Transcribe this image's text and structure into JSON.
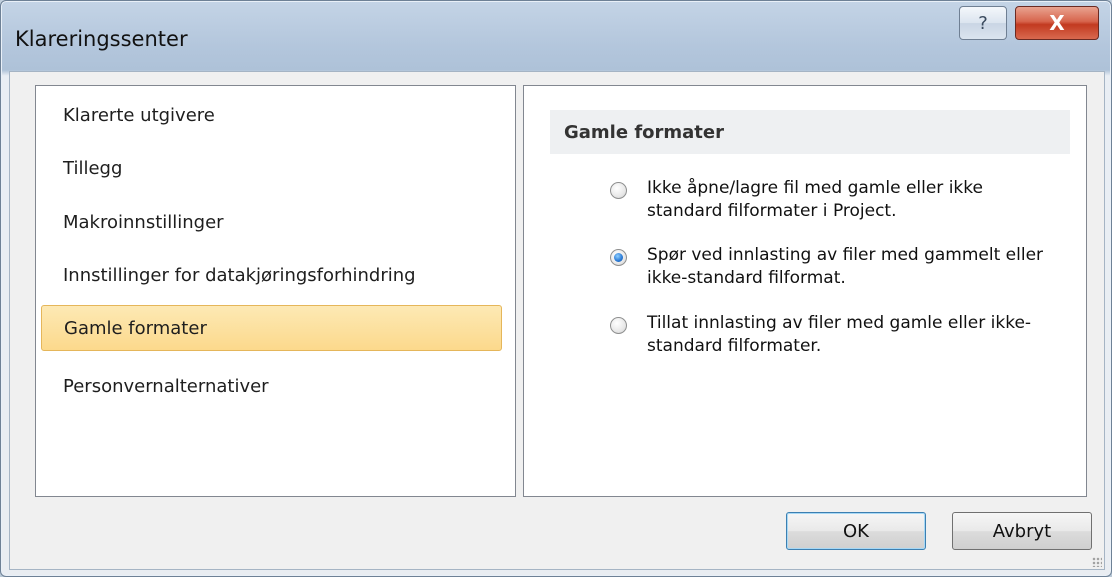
{
  "window": {
    "title": "Klareringssenter",
    "help_label": "?",
    "close_label": "X"
  },
  "nav": {
    "items": [
      {
        "label": "Klarerte utgivere",
        "selected": false
      },
      {
        "label": "Tillegg",
        "selected": false
      },
      {
        "label": "Makroinnstillinger",
        "selected": false
      },
      {
        "label": "Innstillinger for datakjøringsforhindring",
        "selected": false
      },
      {
        "label": "Gamle formater",
        "selected": true
      },
      {
        "label": "Personvernalternativer",
        "selected": false
      }
    ]
  },
  "content": {
    "section_title": "Gamle formater",
    "options": [
      {
        "label": "Ikke åpne/lagre fil med gamle eller ikke standard filformater i Project.",
        "checked": false
      },
      {
        "label": "Spør ved innlasting av filer med gammelt eller ikke-standard filformat.",
        "checked": true
      },
      {
        "label": "Tillat innlasting av filer med gamle eller ikke-standard filformater.",
        "checked": false
      }
    ]
  },
  "buttons": {
    "ok_label": "OK",
    "cancel_label": "Avbryt"
  },
  "colors": {
    "selection_fill": "#fcd98c",
    "selection_border": "#e5b65a",
    "close_red": "#c23a20"
  }
}
